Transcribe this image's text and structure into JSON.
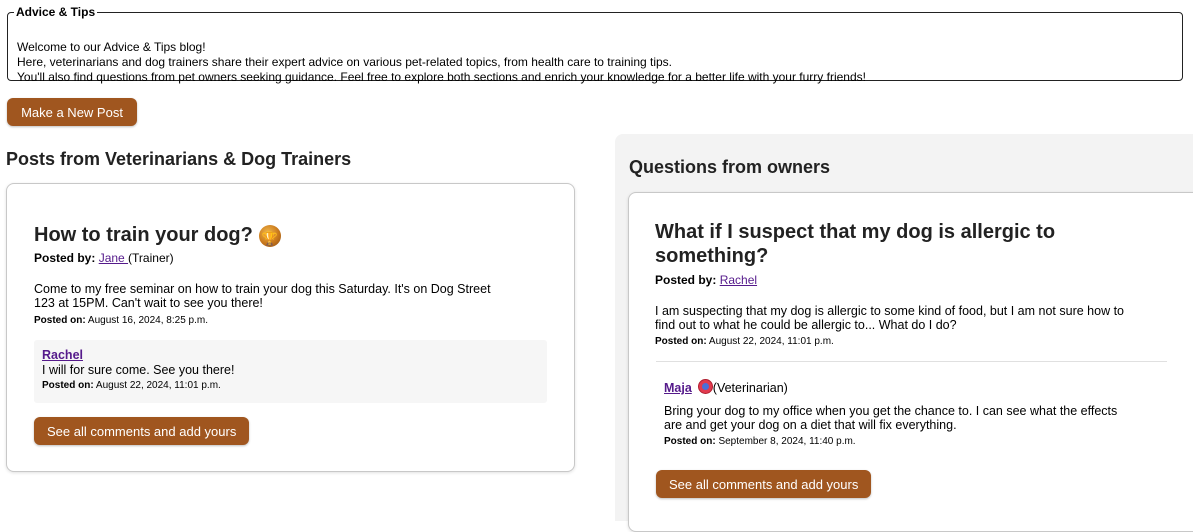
{
  "intro": {
    "legend": "Advice & Tips",
    "lines": [
      "Welcome to our Advice & Tips blog!",
      "Here, veterinarians and dog trainers share their expert advice on various pet-related topics, from health care to training tips.",
      "You'll also find questions from pet owners seeking guidance. Feel free to explore both sections and enrich your knowledge for a better life with your furry friends!"
    ]
  },
  "new_post_label": "Make a New Post",
  "colors": {
    "accent": "#a0561f",
    "panel_bg": "#f3f3f3",
    "link": "#551a8b"
  },
  "left_section": {
    "heading": "Posts from Veterinarians & Dog Trainers",
    "post": {
      "title": "How to train your dog?",
      "icon": "trophy-icon",
      "posted_by_label": "Posted by:",
      "author": "Jane ",
      "author_role": "(Trainer)",
      "body_line1": "Come to my free seminar on how to train your dog this Saturday. It's on Dog Street",
      "body_line2": "123 at 15PM. Can't wait to see you there!",
      "posted_on_label": "Posted on:",
      "posted_on": "August 16, 2024, 8:25 p.m.",
      "comment": {
        "author": "Rachel",
        "text": "I will for sure come. See you there!",
        "posted_on_label": "Posted on:",
        "posted_on": "August 22, 2024, 11:01 p.m."
      },
      "see_all_label": "See all comments and add yours"
    }
  },
  "right_section": {
    "heading": "Questions from owners",
    "post": {
      "title_line1": "What if I suspect that my dog is allergic to",
      "title_line2": "something?",
      "posted_by_label": "Posted by:",
      "author": "Rachel",
      "body_line1": "I am suspecting that my dog is allergic to some kind of food, but I am not sure how to",
      "body_line2": "find out to what he could be allergic to... What do I do?",
      "posted_on_label": "Posted on:",
      "posted_on": "August 22, 2024, 11:01 p.m.",
      "comment": {
        "author": "Maja",
        "badge_icon": "veterinarian-badge-icon",
        "role": "(Veterinarian)",
        "text_line1": "Bring your dog to my office when you get the chance to. I can see what the effects",
        "text_line2": "are and get your dog on a diet that will fix everything.",
        "posted_on_label": "Posted on:",
        "posted_on": "September 8, 2024, 11:40 p.m."
      },
      "see_all_label": "See all comments and add yours"
    }
  }
}
